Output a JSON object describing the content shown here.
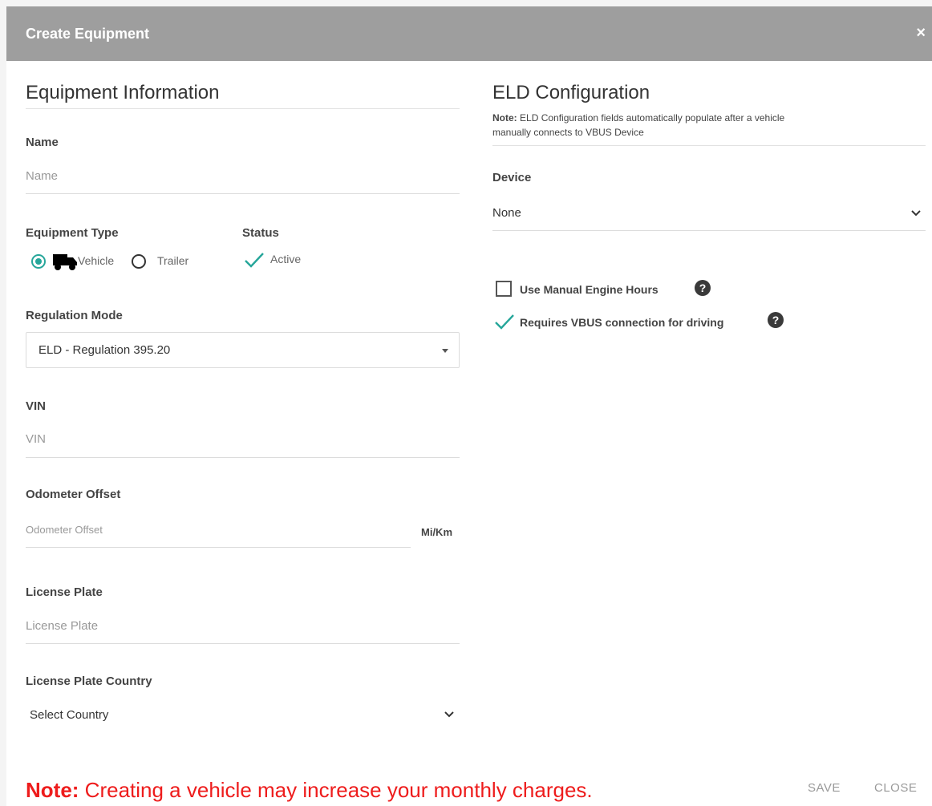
{
  "header": {
    "title": "Create Equipment",
    "close_glyph": "×"
  },
  "equipment_info": {
    "title": "Equipment Information",
    "name": {
      "label": "Name",
      "placeholder": "Name"
    },
    "equipment_type": {
      "label": "Equipment Type",
      "options": [
        "Vehicle",
        "Trailer"
      ],
      "selected": "Vehicle"
    },
    "status": {
      "label": "Status",
      "value": "Active"
    },
    "regulation_mode": {
      "label": "Regulation Mode",
      "value": "ELD - Regulation 395.20"
    },
    "vin": {
      "label": "VIN",
      "placeholder": "VIN"
    },
    "odometer_offset": {
      "label": "Odometer Offset",
      "placeholder": "Odometer Offset",
      "unit": "Mi/Km"
    },
    "license_plate": {
      "label": "License Plate",
      "placeholder": "License Plate"
    },
    "license_plate_country": {
      "label": "License Plate Country",
      "value": "Select Country"
    }
  },
  "eld_config": {
    "title": "ELD Configuration",
    "note_prefix": "Note:",
    "note_text": "ELD Configuration fields automatically populate after a vehicle",
    "note_text_2": "manually connects to VBUS Device",
    "device": {
      "label": "Device",
      "value": "None"
    },
    "use_manual_engine_hours": {
      "label": "Use Manual Engine Hours",
      "checked": false
    },
    "requires_vbus": {
      "label": "Requires VBUS connection for driving",
      "checked": true
    }
  },
  "footer": {
    "note_prefix": "Note:",
    "note_text": "Creating a vehicle may increase your monthly charges.",
    "save_label": "SAVE",
    "close_label": "CLOSE"
  },
  "colors": {
    "header_bg": "#9e9e9e",
    "accent": "#26a69a",
    "note_red": "#ee1c1c"
  }
}
